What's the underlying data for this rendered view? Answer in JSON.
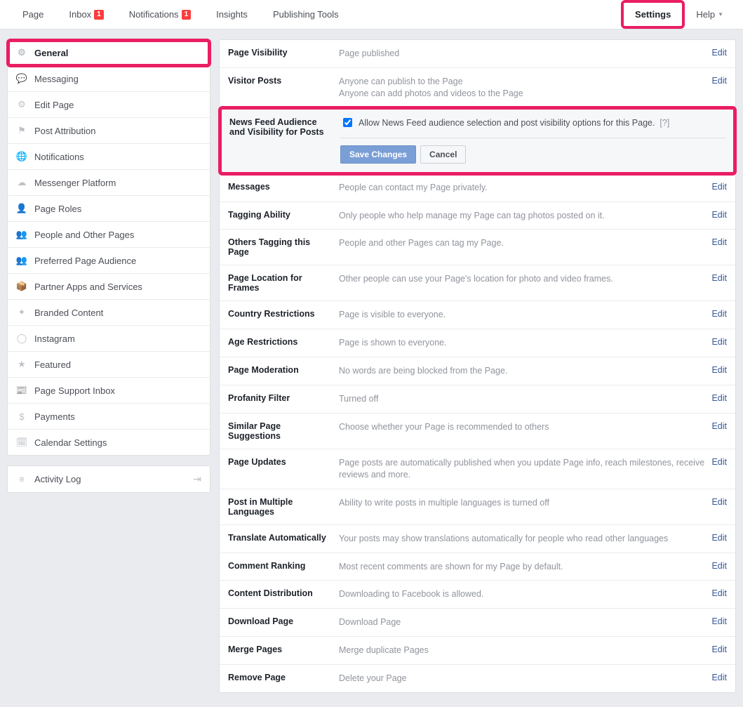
{
  "topnav": {
    "page": "Page",
    "inbox": "Inbox",
    "inbox_badge": "1",
    "notifications": "Notifications",
    "notifications_badge": "1",
    "insights": "Insights",
    "publishing": "Publishing Tools",
    "settings": "Settings",
    "help": "Help"
  },
  "sidebar": {
    "items": [
      {
        "icon": "⚙",
        "label": "General",
        "active": true
      },
      {
        "icon": "💬",
        "label": "Messaging"
      },
      {
        "icon": "⚙",
        "label": "Edit Page"
      },
      {
        "icon": "⚑",
        "label": "Post Attribution"
      },
      {
        "icon": "🌐",
        "label": "Notifications"
      },
      {
        "icon": "☁",
        "label": "Messenger Platform"
      },
      {
        "icon": "👤",
        "label": "Page Roles"
      },
      {
        "icon": "👥",
        "label": "People and Other Pages"
      },
      {
        "icon": "👥",
        "label": "Preferred Page Audience"
      },
      {
        "icon": "📦",
        "label": "Partner Apps and Services"
      },
      {
        "icon": "✦",
        "label": "Branded Content"
      },
      {
        "icon": "◯",
        "label": "Instagram"
      },
      {
        "icon": "★",
        "label": "Featured"
      },
      {
        "icon": "📰",
        "label": "Page Support Inbox"
      },
      {
        "icon": "$",
        "label": "Payments"
      },
      {
        "icon": "🗓",
        "label": "Calendar Settings"
      }
    ],
    "activity": {
      "icon": "≡",
      "label": "Activity Log"
    }
  },
  "settings_rows": [
    {
      "label": "Page Visibility",
      "value": "Page published",
      "edit": "Edit"
    },
    {
      "label": "Visitor Posts",
      "value": "Anyone can publish to the Page\nAnyone can add photos and videos to the Page",
      "edit": "Edit"
    }
  ],
  "expanded": {
    "label": "News Feed Audience and Visibility for Posts",
    "checkbox_text": "Allow News Feed audience selection and post visibility options for this Page.",
    "help": "[?]",
    "save": "Save Changes",
    "cancel": "Cancel"
  },
  "settings_rows2": [
    {
      "label": "Messages",
      "value": "People can contact my Page privately.",
      "edit": "Edit"
    },
    {
      "label": "Tagging Ability",
      "value": "Only people who help manage my Page can tag photos posted on it.",
      "edit": "Edit"
    },
    {
      "label": "Others Tagging this Page",
      "value": "People and other Pages can tag my Page.",
      "edit": "Edit"
    },
    {
      "label": "Page Location for Frames",
      "value": "Other people can use your Page's location for photo and video frames.",
      "edit": "Edit"
    },
    {
      "label": "Country Restrictions",
      "value": "Page is visible to everyone.",
      "edit": "Edit"
    },
    {
      "label": "Age Restrictions",
      "value": "Page is shown to everyone.",
      "edit": "Edit"
    },
    {
      "label": "Page Moderation",
      "value": "No words are being blocked from the Page.",
      "edit": "Edit"
    },
    {
      "label": "Profanity Filter",
      "value": "Turned off",
      "edit": "Edit"
    },
    {
      "label": "Similar Page Suggestions",
      "value": "Choose whether your Page is recommended to others",
      "edit": "Edit"
    },
    {
      "label": "Page Updates",
      "value": "Page posts are automatically published when you update Page info, reach milestones, receive reviews and more.",
      "edit": "Edit"
    },
    {
      "label": "Post in Multiple Languages",
      "value": "Ability to write posts in multiple languages is turned off",
      "edit": "Edit"
    },
    {
      "label": "Translate Automatically",
      "value": "Your posts may show translations automatically for people who read other languages",
      "edit": "Edit"
    },
    {
      "label": "Comment Ranking",
      "value": "Most recent comments are shown for my Page by default.",
      "edit": "Edit"
    },
    {
      "label": "Content Distribution",
      "value": "Downloading to Facebook is allowed.",
      "edit": "Edit"
    },
    {
      "label": "Download Page",
      "value": "Download Page",
      "edit": "Edit"
    },
    {
      "label": "Merge Pages",
      "value": "Merge duplicate Pages",
      "edit": "Edit"
    },
    {
      "label": "Remove Page",
      "value": "Delete your Page",
      "edit": "Edit"
    }
  ]
}
